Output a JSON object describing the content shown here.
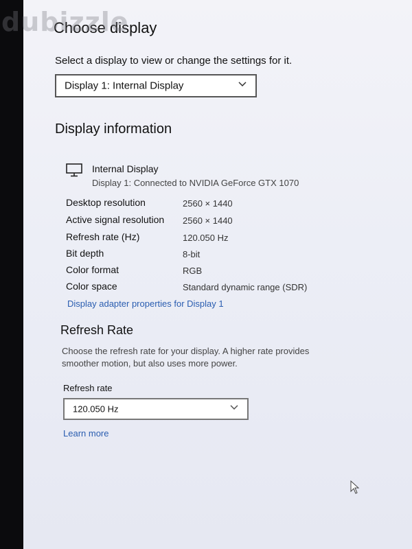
{
  "watermark": "dubizzle",
  "header": {
    "title": "Choose display",
    "select_label": "Select a display to view or change the settings for it.",
    "display_dropdown_value": "Display 1: Internal Display"
  },
  "display_info": {
    "heading": "Display information",
    "monitor_icon": "monitor-icon",
    "name": "Internal Display",
    "connection": "Display 1: Connected to NVIDIA GeForce GTX 1070",
    "rows": [
      {
        "label": "Desktop resolution",
        "value": "2560 × 1440"
      },
      {
        "label": "Active signal resolution",
        "value": "2560 × 1440"
      },
      {
        "label": "Refresh rate (Hz)",
        "value": "120.050 Hz"
      },
      {
        "label": "Bit depth",
        "value": "8-bit"
      },
      {
        "label": "Color format",
        "value": "RGB"
      },
      {
        "label": "Color space",
        "value": "Standard dynamic range (SDR)"
      }
    ],
    "adapter_link": "Display adapter properties for Display 1"
  },
  "refresh_rate": {
    "heading": "Refresh Rate",
    "description": "Choose the refresh rate for your display. A higher rate provides smoother motion, but also uses more power.",
    "label": "Refresh rate",
    "dropdown_value": "120.050 Hz",
    "learn_more": "Learn more"
  },
  "colors": {
    "link": "#2a5db0",
    "background": "#eceef6"
  }
}
